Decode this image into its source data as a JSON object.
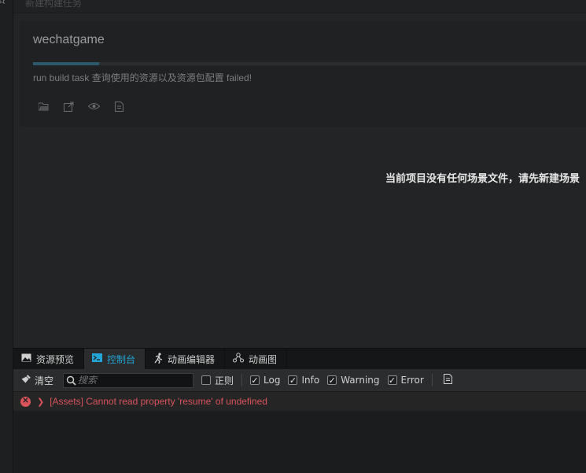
{
  "header": {
    "title": "新建构建任务"
  },
  "task": {
    "name": "wechatgame",
    "progress_percent": 12,
    "message": "run build task 查询使用的资源以及资源包配置 failed!",
    "actions": [
      "folder-open-icon",
      "export-icon",
      "eye-icon",
      "log-file-icon"
    ]
  },
  "scene": {
    "empty_message": "当前项目没有任何场景文件，请先新建场景"
  },
  "tabs": [
    {
      "label": "资源预览",
      "icon": "image-icon",
      "active": false
    },
    {
      "label": "控制台",
      "icon": "terminal-icon",
      "active": true
    },
    {
      "label": "动画编辑器",
      "icon": "running-man-icon",
      "active": false
    },
    {
      "label": "动画图",
      "icon": "graph-icon",
      "active": false
    }
  ],
  "toolbar": {
    "clear_label": "清空",
    "search_placeholder": "搜索",
    "regex_label": "正则",
    "regex_checked": false,
    "filters": [
      {
        "label": "Log",
        "checked": true
      },
      {
        "label": "Info",
        "checked": true
      },
      {
        "label": "Warning",
        "checked": true
      },
      {
        "label": "Error",
        "checked": true
      }
    ]
  },
  "logs": [
    {
      "level": "error",
      "text": "[Assets] Cannot read property 'resume' of undefined"
    }
  ],
  "colors": {
    "accent": "#22a6d8",
    "error": "#d9535b",
    "progress": "#2c5a6a"
  }
}
